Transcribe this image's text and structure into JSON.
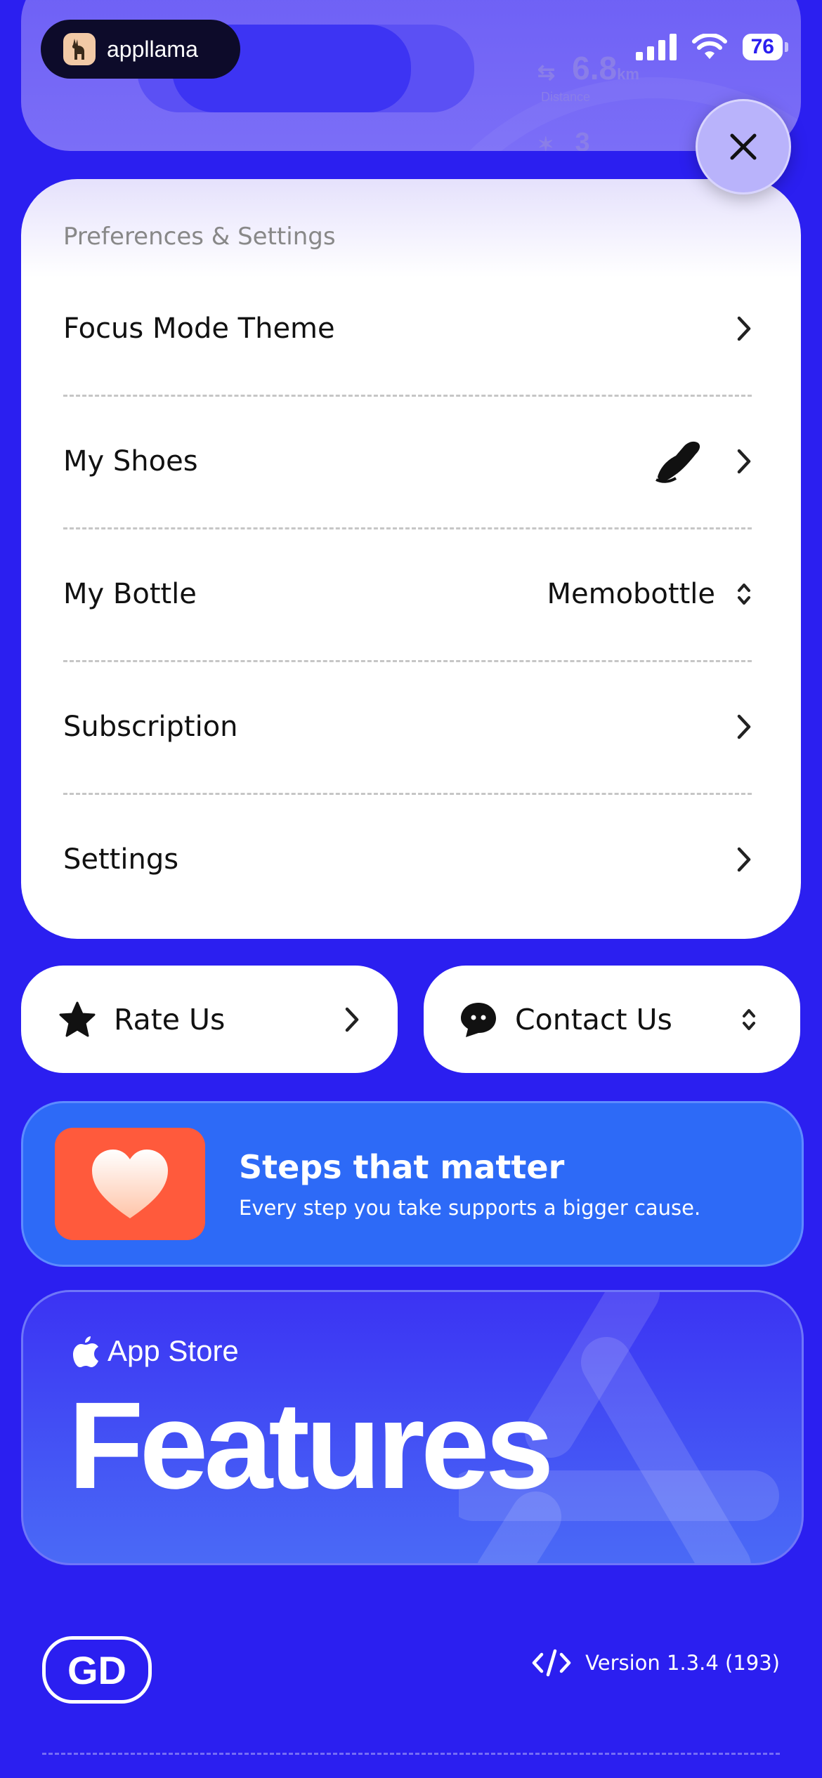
{
  "colors": {
    "background": "#2b1ff0",
    "banner": "#2d6af7",
    "heart_bg": "#ff5a3c",
    "card": "#ffffff"
  },
  "status_bar": {
    "app_badge": "appllama",
    "battery": "76"
  },
  "background_peek": {
    "distance_value": "6.8",
    "distance_unit": "km",
    "distance_label": "Distance",
    "secondary_value": "3"
  },
  "menu": {
    "section_title": "Preferences & Settings",
    "items": [
      {
        "label": "Focus Mode Theme",
        "icon": "chevron-right-icon"
      },
      {
        "label": "My Shoes",
        "icon": "shoe-icon"
      },
      {
        "label": "My Bottle",
        "value": "Memobottle",
        "icon": "chevron-updown-icon"
      },
      {
        "label": "Subscription",
        "icon": "chevron-right-icon"
      },
      {
        "label": "Settings",
        "icon": "chevron-right-icon"
      }
    ]
  },
  "actions": {
    "rate": {
      "label": "Rate Us",
      "icon": "star-icon"
    },
    "contact": {
      "label": "Contact Us",
      "icon": "chat-bubble-icon"
    }
  },
  "banner": {
    "title": "Steps that matter",
    "subtitle": "Every step you take supports a bigger cause."
  },
  "feature_card": {
    "store_label": "App Store",
    "headline": "Features"
  },
  "footer": {
    "logo": "GD",
    "version": "Version 1.3.4 (193)"
  }
}
